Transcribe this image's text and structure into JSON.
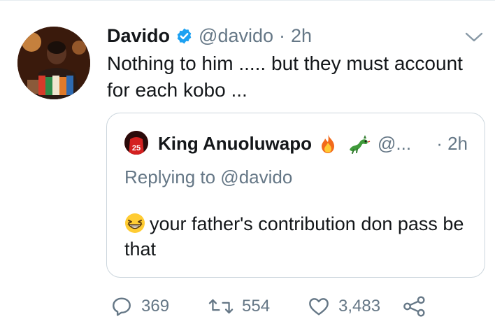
{
  "tweet": {
    "author_name": "Davido",
    "handle": "@davido",
    "separator": "·",
    "time": "2h",
    "text": "Nothing to him ..... but they must account for each kobo ..."
  },
  "quoted_tweet": {
    "author_name": "King Anuoluwapo",
    "handle": "@...",
    "time": "· 2h",
    "replying_to": "Replying to @davido",
    "text": "your father's contribution don pass be that",
    "avatar_jersey_number": "25"
  },
  "actions": {
    "replies": "369",
    "retweets": "554",
    "likes": "3,483"
  },
  "icons": {
    "verified": "verified-badge-icon",
    "caret": "chevron-down-icon",
    "fire": "fire-emoji-icon",
    "dragon": "dragon-emoji-icon",
    "laugh": "grinning-squinting-emoji-icon",
    "reply": "reply-icon",
    "retweet": "retweet-icon",
    "like": "heart-icon",
    "share": "share-icon"
  },
  "colors": {
    "text": "#14171a",
    "secondary": "#657786",
    "border": "#ccd6dd",
    "verified": "#1da1f2"
  }
}
